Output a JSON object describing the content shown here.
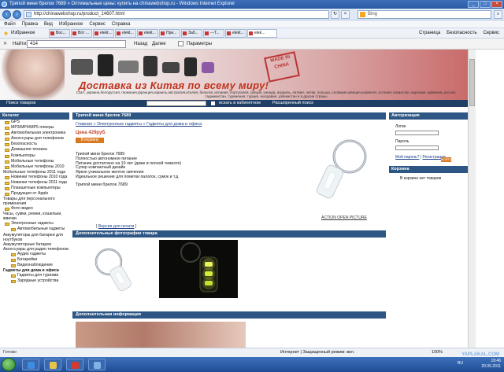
{
  "window": {
    "title": "Трипой мини брелок 7689 » Оптимальные цены: купить на chinawebshop.ru - Windows Internet Explorer"
  },
  "address": {
    "url": "http://chinawebshop.ru/product_14607.html",
    "search_placeholder": "Bing"
  },
  "menu": [
    "Файл",
    "Правка",
    "Вид",
    "Избранное",
    "Сервис",
    "Справка"
  ],
  "favorites": {
    "label": "Избранное",
    "tabs": [
      "Вос...",
      "Вот ...",
      "elekt...",
      "elekt...",
      "elekt...",
      "При...",
      "Заб...",
      "---Т...",
      "elekt...",
      "elek..."
    ],
    "tools": [
      "Страница",
      "Безопасность",
      "Сервис"
    ]
  },
  "findbar": {
    "label": "Найти:",
    "value": "414",
    "prev": "Назад",
    "next": "Далее",
    "options": "Параметры"
  },
  "banner": {
    "slogan": "Доставка из Китая по всему миру!",
    "stamp": "MADE IN CHINA",
    "countries": "США, украина,белоруссия, германия,франция,израиль,австралия,италия, бельгия, испания, португалия, греция, канада, израиль, латвия, литва, польша, словакия,швеция,норвегия, эстония, казахстан, киргизия, армения, россия, таджикистан, туркмения, турция, молдавия, узбекистан и в другие страны"
  },
  "searchstrip": {
    "label": "Поиск товаров",
    "in_category": "искать в кабинетном",
    "advanced": "Расширенный поиск"
  },
  "catalog": {
    "title": "Каталог",
    "items": [
      {
        "label": "GPS",
        "level": 0
      },
      {
        "label": "MP3/MP4/MP5 плееры",
        "level": 0
      },
      {
        "label": "Автомобильная электроника",
        "level": 0
      },
      {
        "label": "Аксессуары для телефонов",
        "level": 0
      },
      {
        "label": "Безопасность",
        "level": 0
      },
      {
        "label": "Домашняя техника",
        "level": 0
      },
      {
        "label": "Компьютеры",
        "level": 0
      },
      {
        "label": "Мобильные телефоны",
        "level": 0
      },
      {
        "label": "Мобильные телефоны 2010",
        "level": 0
      },
      {
        "label": "Мобильные телефоны 2011 года",
        "level": 0,
        "wrap": true
      },
      {
        "label": "Новинки телефоны 2010 года",
        "level": 0
      },
      {
        "label": "Новинки телефоны 2011 года",
        "level": 0
      },
      {
        "label": "Планшетные компьютеры",
        "level": 0
      },
      {
        "label": "Продукция от Apple",
        "level": 0
      },
      {
        "label": "Товары для персонального применения",
        "level": 0,
        "wrap": true
      },
      {
        "label": "Фото видео",
        "level": 0
      },
      {
        "label": "Часы, сумки, ремни, кошельки, жвачки",
        "level": 0,
        "wrap": true
      },
      {
        "label": "Электронные гаджеты",
        "level": 0
      },
      {
        "label": "Автомобильные гаджеты",
        "level": 1
      },
      {
        "label": "Аккумуляторы для батареи для ноутбуков",
        "level": 1,
        "wrap": true
      },
      {
        "label": "Аккумуляторные батареи",
        "level": 1,
        "wrap": true
      },
      {
        "label": "Аксессуары для радио телефонов",
        "level": 1,
        "wrap": true
      },
      {
        "label": "Аудио гаджеты",
        "level": 1
      },
      {
        "label": "Батарейки",
        "level": 1
      },
      {
        "label": "Видеонаблюдение",
        "level": 1
      },
      {
        "label": "Гаджеты для дома и офиса",
        "level": 1,
        "bold": true,
        "wrap": true
      },
      {
        "label": "Гаджеты для туризма",
        "level": 1
      },
      {
        "label": "Зарядные устройства",
        "level": 1
      }
    ]
  },
  "product": {
    "header": "Трипой мини брелок 7689",
    "breadcrumb": "Главная » Электронные гаджеты » Гаджеты для дома и офиса",
    "price": "Цена 429руб.",
    "buy": "В корзину",
    "description": [
      "Трипой мини брелок 7689",
      "Полностью автономное питание",
      "Питание достаточно на 10 лет (даже в полной темноте)",
      "Супер компактный дизайн",
      "Яркое уникальное желтое свечение",
      "Идеальное решение для пометки палаток, сумок и т.д"
    ],
    "title2": "Трипой мини брелок 7689",
    "action": "ACTION  OPEN  PICTURE",
    "print_prefix": "[ ",
    "print_link": "Версия для печати",
    "print_suffix": " ]",
    "photos_header": "Дополнительные фотографии товара",
    "info_header": "Дополнительная информация"
  },
  "auth": {
    "title": "Авторизация",
    "login_label": "Логин",
    "password_label": "Пароль",
    "go": "ВОЙТИ",
    "forgot": "Мой пароль?",
    "register": "Регистрация",
    "separator": " | "
  },
  "cart": {
    "title": "Корзина",
    "empty": "В корзине нет товаров"
  },
  "status": {
    "text": "Готово",
    "zone": "Интернет | Защищенный режим: вкл.",
    "zoom": "100%"
  },
  "taskbar": {
    "lang": "RU",
    "time": "19:46",
    "date": "20.05.2011"
  },
  "watermark": "YAPLAKAL.COM"
}
